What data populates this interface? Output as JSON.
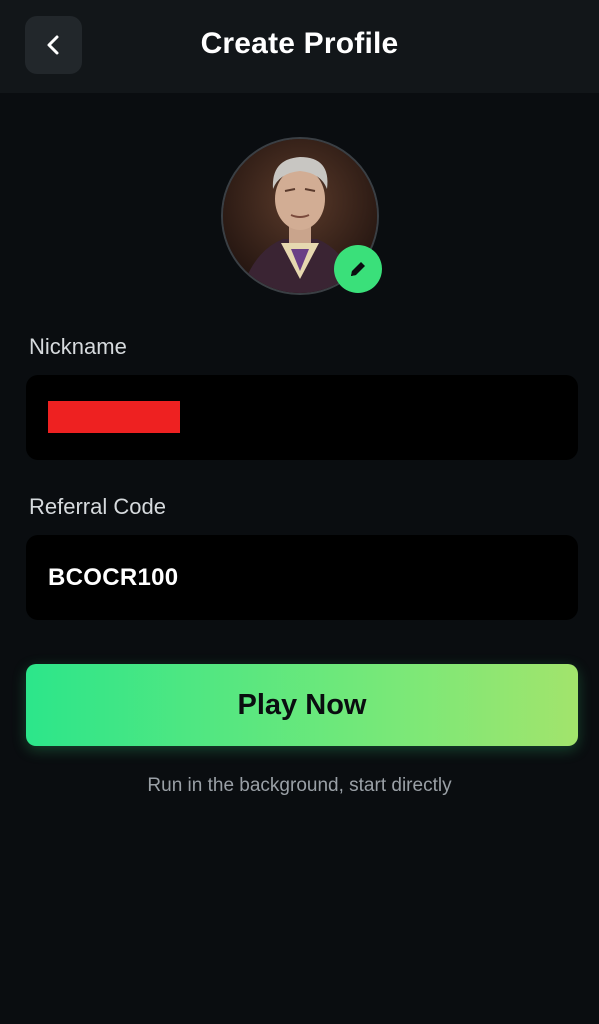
{
  "header": {
    "title": "Create Profile",
    "back_icon": "chevron-left-icon"
  },
  "avatar": {
    "image": "portrait-illustration",
    "edit_icon": "pencil-icon"
  },
  "nickname": {
    "label": "Nickname",
    "value": ""
  },
  "referral": {
    "label": "Referral Code",
    "value": "BCOCR100"
  },
  "play_button": {
    "label": "Play Now"
  },
  "hint": "Run in the background, start directly",
  "colors": {
    "background": "#0a0d10",
    "header": "#121619",
    "accent": "#3ae07a",
    "field": "#000000",
    "redaction": "#ee2121"
  }
}
